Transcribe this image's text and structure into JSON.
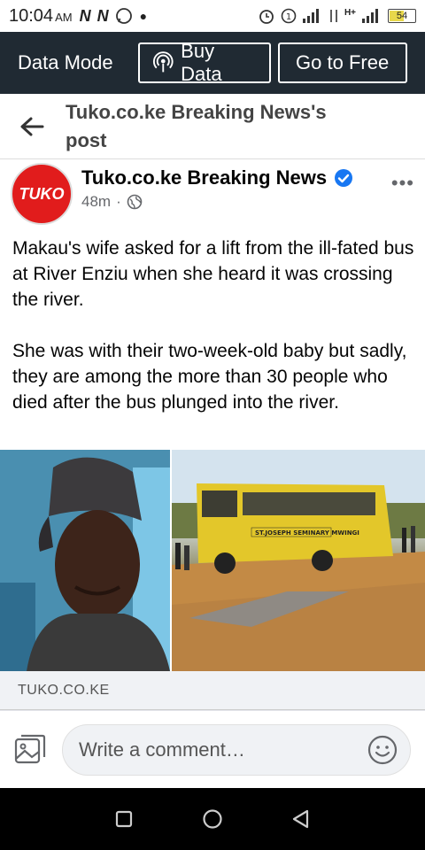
{
  "status": {
    "time": "10:04",
    "ampm": "AM",
    "battery": "54",
    "network": "H+"
  },
  "data_bar": {
    "mode_label": "Data Mode",
    "buy_label": "Buy Data",
    "free_label": "Go to Free"
  },
  "header": {
    "title": "Tuko.co.ke Breaking News's post"
  },
  "post": {
    "avatar_text": "TUKO",
    "author": "Tuko.co.ke Breaking News",
    "time": "48m",
    "paragraphs": [
      "Makau's wife asked for a lift from the ill-fated bus at River Enziu when she heard it was crossing the river.",
      "She was with their two-week-old baby but sadly, they are among the more than 30 people who died after the bus plunged into the river."
    ],
    "bus_text": "ST.JOSEPH SEMINARY MWINGI",
    "link_source": "TUKO.CO.KE"
  },
  "comment": {
    "placeholder": "Write a comment…"
  },
  "colors": {
    "data_bar_bg": "#202a33",
    "brand_red": "#e11c1c",
    "verified_blue": "#1877f2",
    "bus_yellow": "#e3c72a"
  }
}
